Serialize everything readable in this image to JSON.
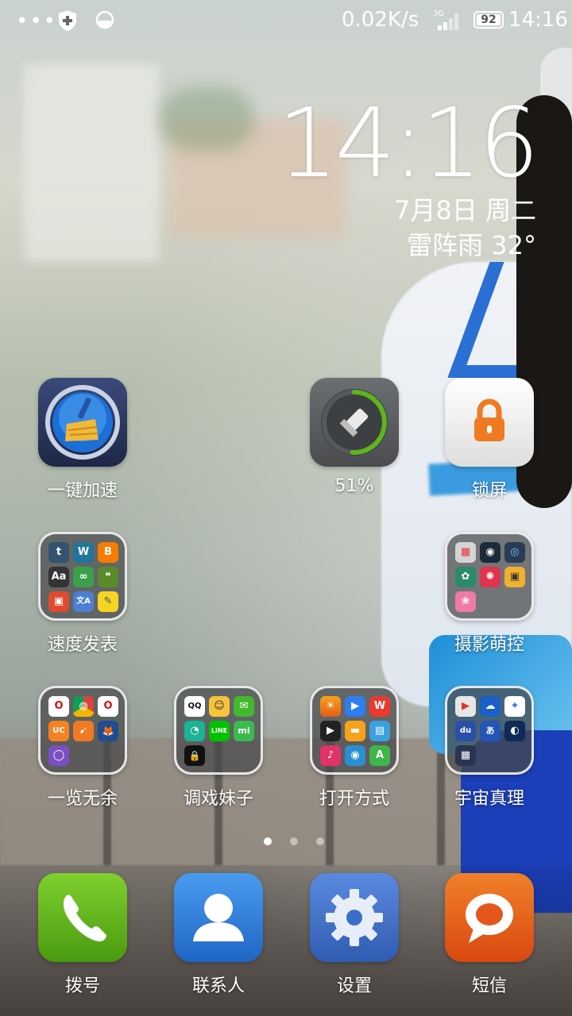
{
  "status_bar": {
    "dots": "•••",
    "net_speed": "0.02K/s",
    "network_type": "3G",
    "battery": "92",
    "time": "14:16"
  },
  "clock_widget": {
    "time": "14:16",
    "date": "7月8日 周二",
    "weather": "雷阵雨 32°"
  },
  "row1": {
    "speedup": {
      "label": "一键加速",
      "icon": "broom-speed-icon"
    },
    "memory": {
      "label": "51%",
      "icon": "memory-cleaner-icon",
      "percent": 51
    },
    "lock": {
      "label": "锁屏",
      "icon": "lock-icon"
    }
  },
  "folders": {
    "blogs": {
      "label": "速度发表",
      "apps": [
        "t",
        "W",
        "B",
        "Aa",
        "∞",
        "❝",
        "▣",
        "文A",
        "✎"
      ]
    },
    "photo": {
      "label": "摄影萌控",
      "apps": [
        "▦",
        "◉",
        "◎",
        "✿",
        "✺",
        "▣",
        "❀"
      ]
    },
    "browsers": {
      "label": "一览无余",
      "apps": [
        "O",
        "◍",
        "O",
        "UC",
        "➹",
        "🦊",
        "◯"
      ]
    },
    "social": {
      "label": "调戏妹子",
      "apps": [
        "QQ",
        "☺",
        "✉",
        "◔",
        "LINE",
        "mi",
        "🔒"
      ]
    },
    "tools": {
      "label": "打开方式",
      "apps": [
        "☀",
        "▶",
        "W",
        "▶",
        "▬",
        "▤",
        "♪",
        "◉",
        "A"
      ]
    },
    "universe": {
      "label": "宇宙真理",
      "apps": [
        "▶",
        "☁",
        "✦",
        "du",
        "あ",
        "◐",
        "▦"
      ]
    }
  },
  "dock": {
    "dialer": {
      "label": "拨号",
      "icon": "phone-icon"
    },
    "contacts": {
      "label": "联系人",
      "icon": "contact-icon"
    },
    "settings": {
      "label": "设置",
      "icon": "gear-icon"
    },
    "messages": {
      "label": "短信",
      "icon": "message-icon"
    }
  },
  "pages": {
    "count": 3,
    "active": 1
  },
  "colors": {
    "accent_green": "#5fb51b",
    "dialer_green": "#5fb51b",
    "contacts_blue": "#2a7de0",
    "settings_blue": "#3b6fc6",
    "messages_orange": "#e4571c",
    "lock_orange": "#f07a22"
  }
}
